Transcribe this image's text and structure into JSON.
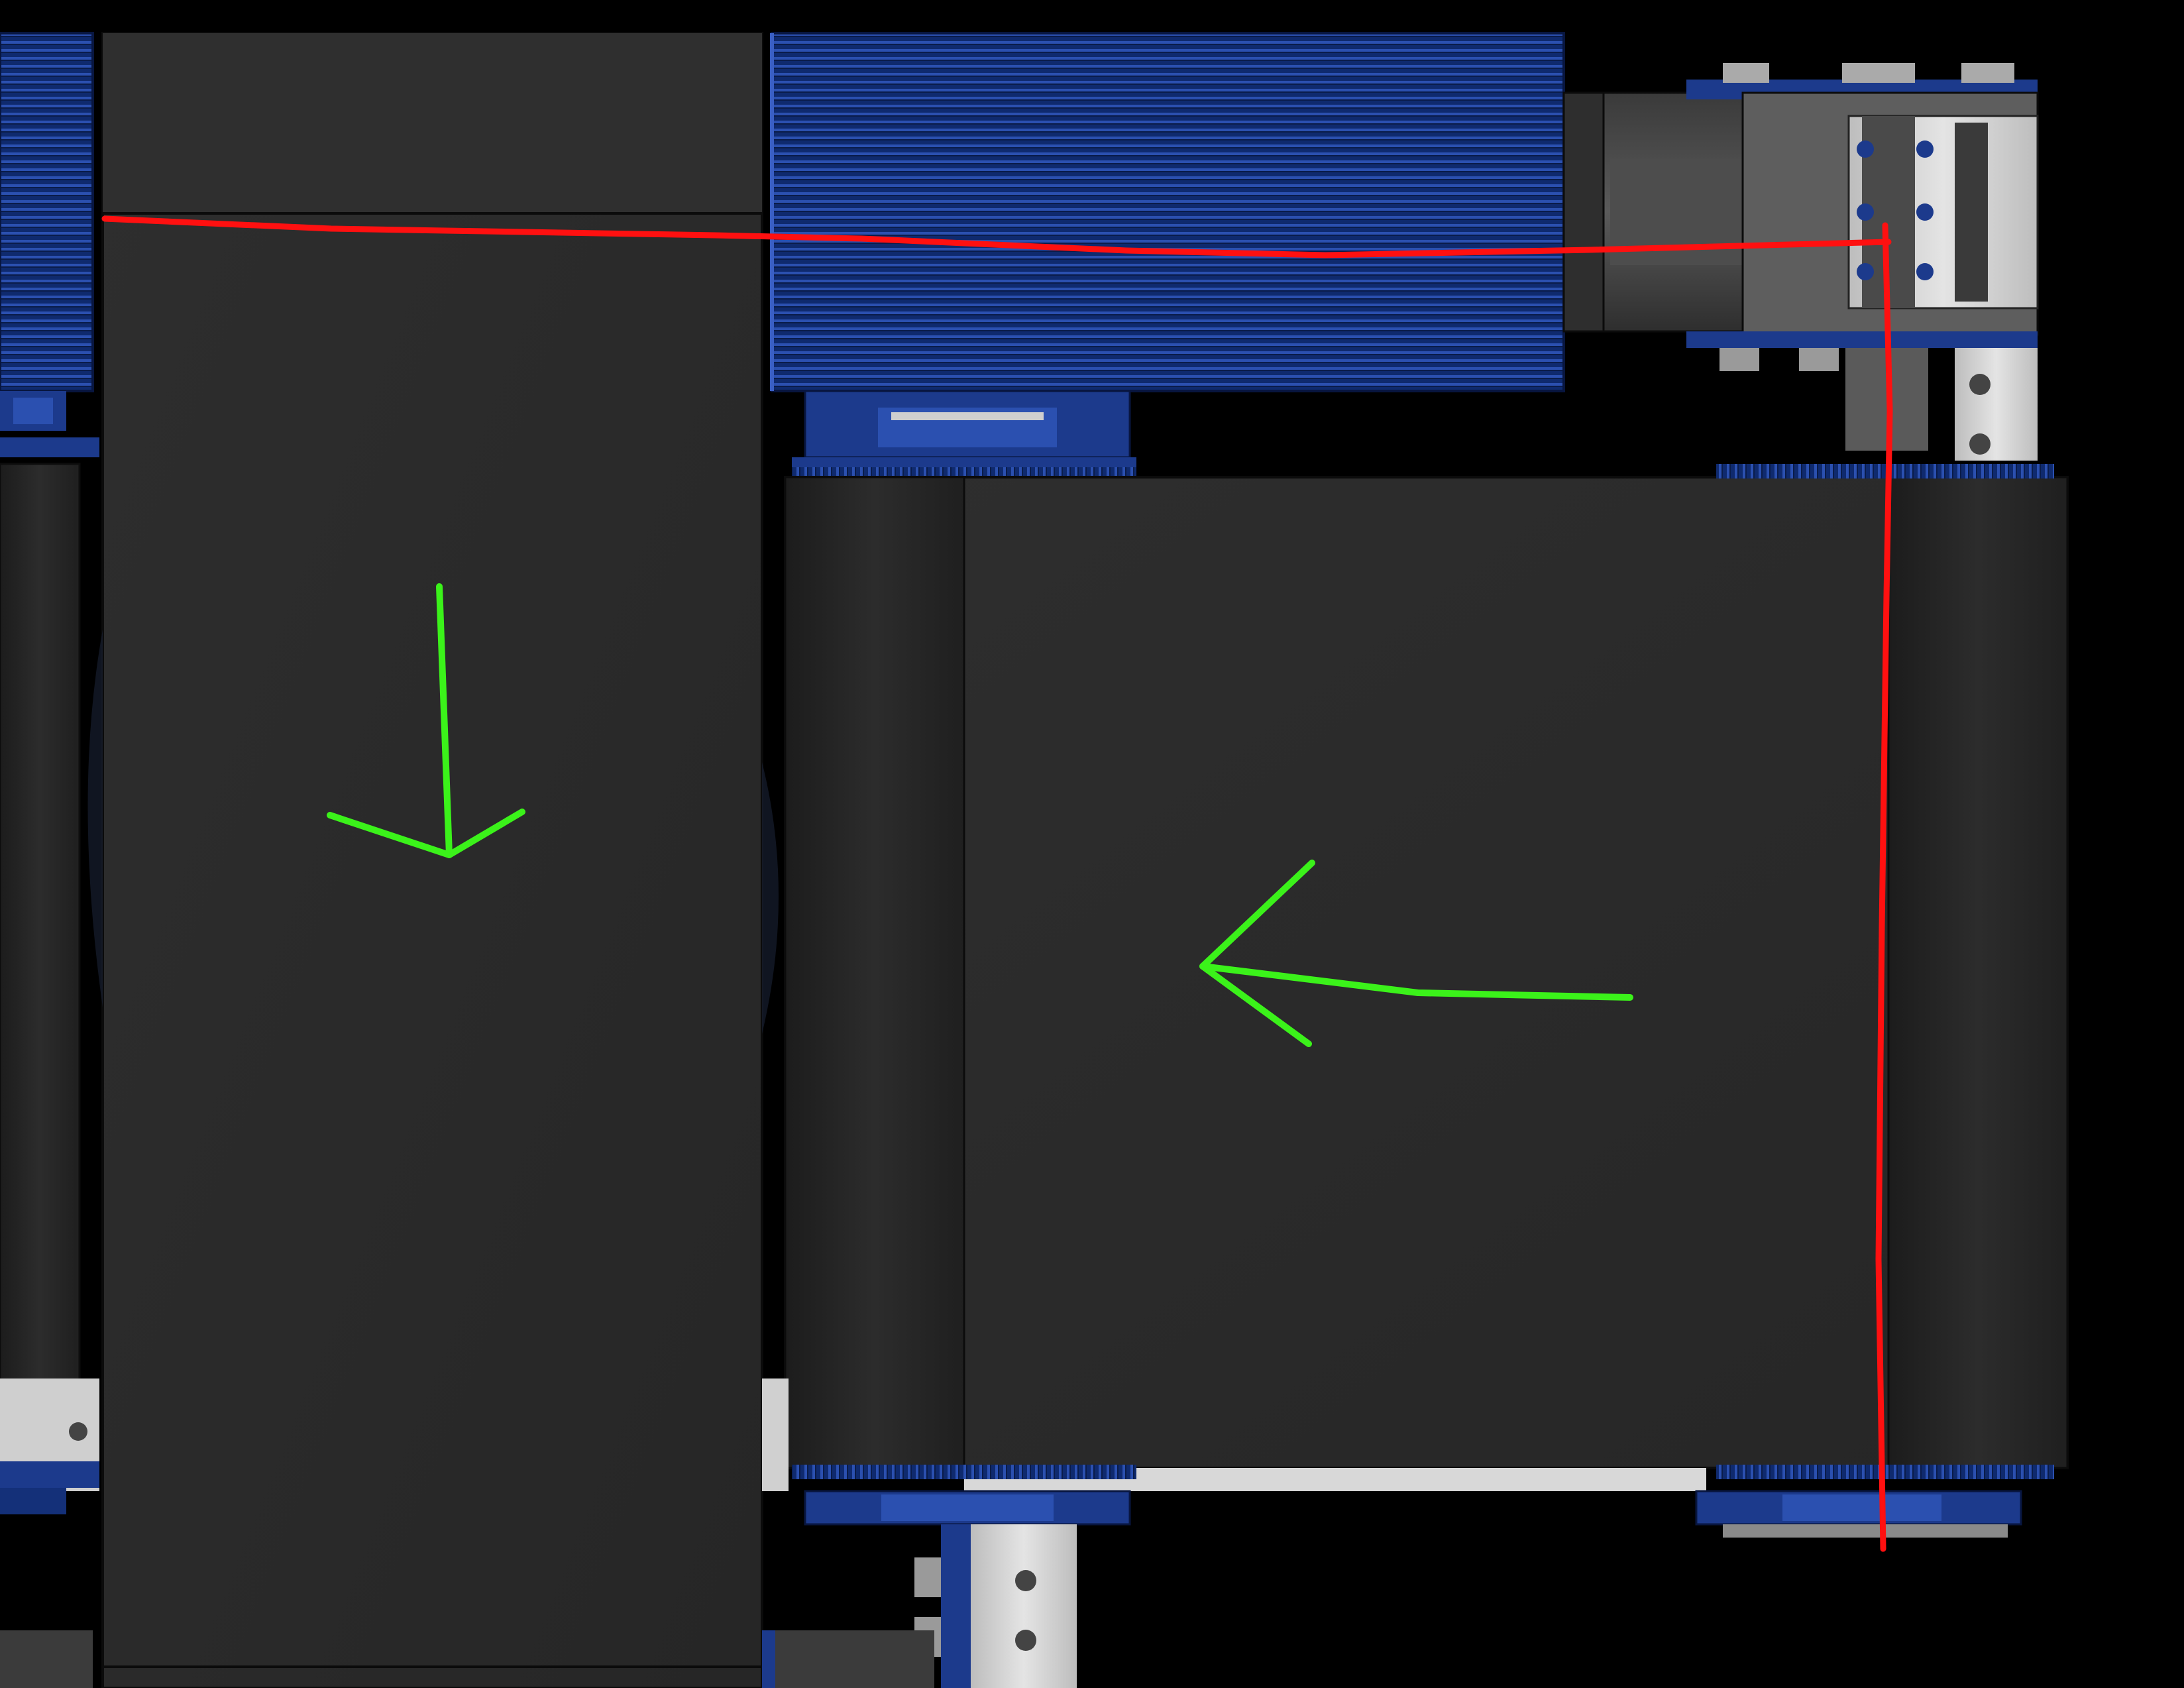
{
  "image": {
    "kind": "CAD render of a belt/roller conveyor assembly (top view) with hand-drawn annotations"
  },
  "colors": {
    "background": "#000000",
    "belt_dark": "#2a2a2a",
    "belt_edge": "#111111",
    "anodized_blue": "#1c3a8c",
    "blue_highlight": "#3a5fc4",
    "steel_light": "#d6d6d6",
    "steel_mid": "#6e6e6e",
    "annotation_red": "#ff1010",
    "annotation_green": "#3bf21a"
  },
  "parts": {
    "belts": [
      "left-vertical-belt",
      "center-vertical-belt",
      "right-horizontal-belt"
    ],
    "pulleys": [
      "left-ribbed-pulley",
      "top-ribbed-pulley"
    ],
    "motor": "gearbox-motor",
    "brackets": [
      "upper-right-bracket",
      "lower-center-bracket"
    ]
  },
  "annotations": {
    "arrows": [
      {
        "color": "green",
        "direction": "down"
      },
      {
        "color": "green",
        "direction": "left"
      }
    ],
    "lines": [
      {
        "color": "red",
        "orientation": "horizontal"
      },
      {
        "color": "red",
        "orientation": "vertical"
      }
    ]
  }
}
